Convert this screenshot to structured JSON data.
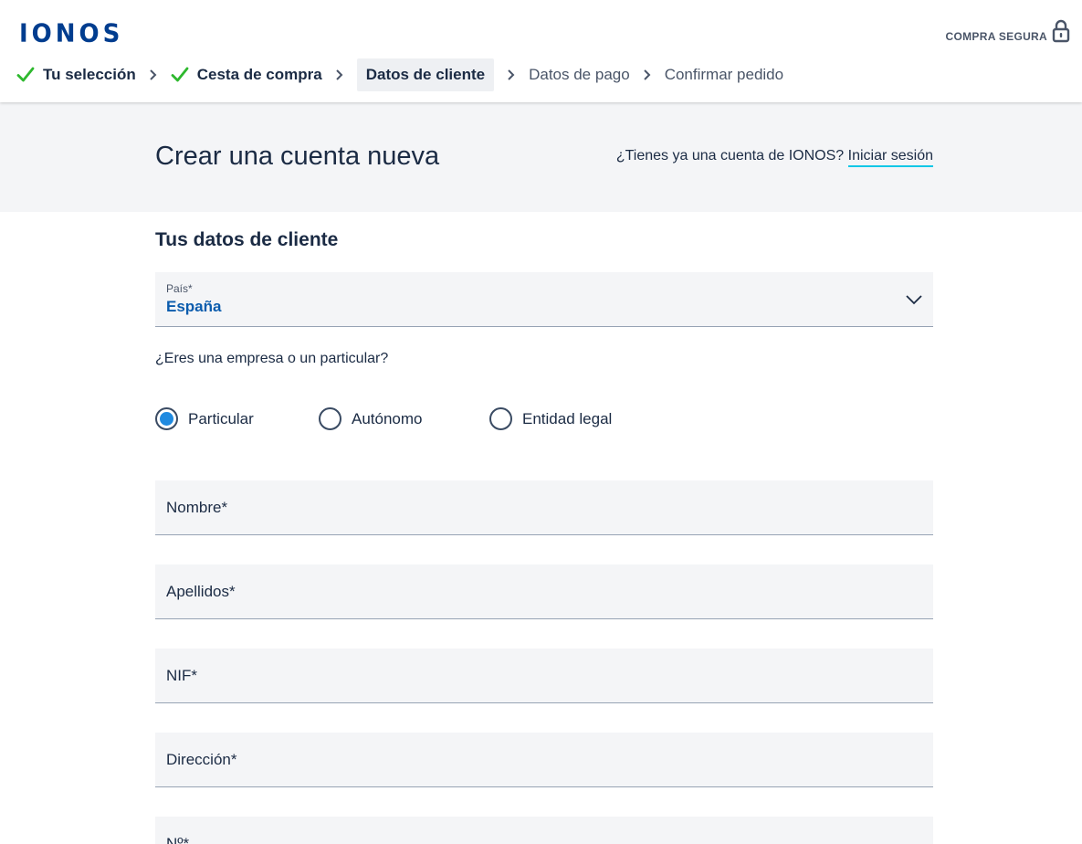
{
  "header": {
    "logo": "IONOS",
    "secure_label": "COMPRA SEGURA",
    "steps": [
      {
        "label": "Tu selección",
        "state": "done"
      },
      {
        "label": "Cesta de compra",
        "state": "done"
      },
      {
        "label": "Datos de cliente",
        "state": "current"
      },
      {
        "label": "Datos de pago",
        "state": "pending"
      },
      {
        "label": "Confirmar pedido",
        "state": "pending"
      }
    ]
  },
  "band": {
    "title": "Crear una cuenta nueva",
    "login_question": "¿Tienes ya una cuenta de IONOS?",
    "login_link": "Iniciar sesión"
  },
  "form": {
    "section_title": "Tus datos de cliente",
    "country": {
      "label": "País*",
      "value": "España"
    },
    "question": "¿Eres una empresa o un particular?",
    "radios": [
      {
        "label": "Particular",
        "checked": true
      },
      {
        "label": "Autónomo",
        "checked": false
      },
      {
        "label": "Entidad legal",
        "checked": false
      }
    ],
    "fields": [
      {
        "label": "Nombre*"
      },
      {
        "label": "Apellidos*"
      },
      {
        "label": "NIF*"
      },
      {
        "label": "Dirección*"
      },
      {
        "label": "Nº*"
      }
    ]
  },
  "colors": {
    "brand": "#003d8f",
    "check": "#2eb82e",
    "radio_selected": "#1f8ae0",
    "link_underline": "#11c7e6"
  }
}
